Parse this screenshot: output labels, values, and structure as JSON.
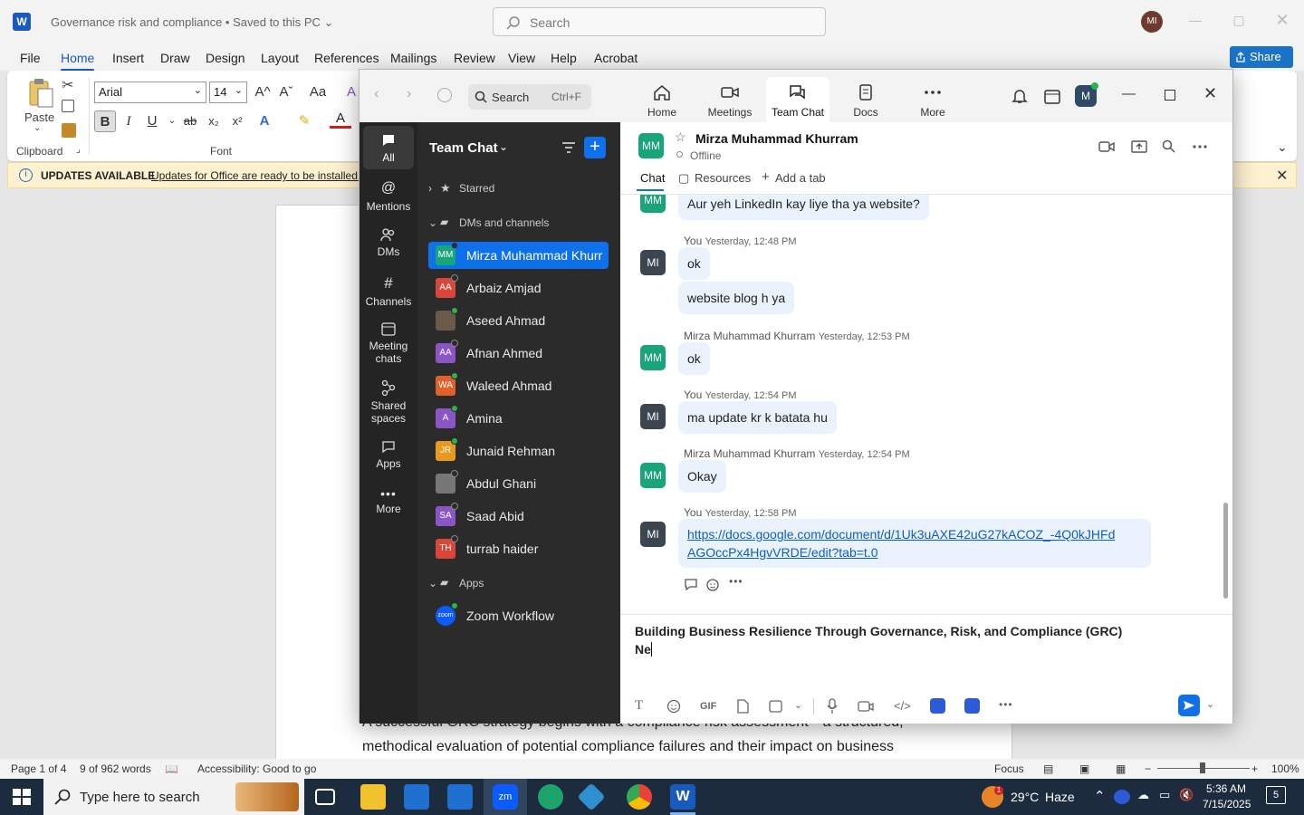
{
  "word": {
    "app_letter": "W",
    "doc_title": "Governance risk and compliance • Saved to this PC ⌄",
    "search_placeholder": "Search",
    "avatar": "MI",
    "share_label": "Share",
    "menu": [
      "File",
      "Home",
      "Insert",
      "Draw",
      "Design",
      "Layout",
      "References",
      "Mailings",
      "Review",
      "View",
      "Help",
      "Acrobat"
    ],
    "ribbon": {
      "paste_label": "Paste",
      "clipboard_label": "Clipboard",
      "font_label": "Font",
      "font_name": "Arial",
      "font_size": "14",
      "grow": "A^",
      "shrink": "Aˇ",
      "case": "Aa",
      "bold": "B",
      "italic": "I",
      "underline": "U",
      "strike": "ab",
      "sub": "x₂",
      "sup": "x²"
    },
    "update_bar": {
      "title": "UPDATES AVAILABLE",
      "message": "Updates for Office are ready to be installed..."
    },
    "doc_lines": [
      "A successful GRC strategy begins with a compliance risk assessment—a structured,",
      "methodical evaluation of potential compliance failures and their impact on business"
    ],
    "status": {
      "page": "Page 1 of 4",
      "words": "9 of 962 words",
      "accessibility": "Accessibility: Good to go",
      "focus": "Focus",
      "zoom": "100%"
    }
  },
  "taskbar": {
    "search_placeholder": "Type here to search",
    "weather_temp": "29°C",
    "weather_desc": "Haze",
    "time": "5:36 AM",
    "date": "7/15/2025",
    "notif_count": "5",
    "weather_badge": "1"
  },
  "zoom": {
    "search_placeholder": "Search",
    "search_shortcut": "Ctrl+F",
    "tabs": [
      {
        "label": "Home",
        "icon": "home-icon"
      },
      {
        "label": "Meetings",
        "icon": "video-icon"
      },
      {
        "label": "Team Chat",
        "icon": "chat-icon"
      },
      {
        "label": "Docs",
        "icon": "docs-icon"
      },
      {
        "label": "More",
        "icon": "more-icon"
      }
    ],
    "profile_initials": "M",
    "nav": [
      {
        "label": "All"
      },
      {
        "label": "Mentions"
      },
      {
        "label": "DMs"
      },
      {
        "label": "Channels"
      },
      {
        "label": "Meeting chats"
      },
      {
        "label": "Shared spaces"
      },
      {
        "label": "Apps"
      },
      {
        "label": "More"
      }
    ],
    "list": {
      "title": "Team Chat",
      "starred": "Starred",
      "dms_section": "DMs and channels",
      "apps_section": "Apps",
      "contacts": [
        {
          "initials": "MM",
          "name": "Mirza Muhammad Khurram",
          "color": "#19a57a"
        },
        {
          "initials": "AA",
          "name": "Arbaiz Amjad",
          "color": "#d9473a"
        },
        {
          "initials": "",
          "name": "Aseed Ahmad",
          "color": "#6b5a4a"
        },
        {
          "initials": "AA",
          "name": "Afnan Ahmed",
          "color": "#8b55c5"
        },
        {
          "initials": "WA",
          "name": "Waleed Ahmad",
          "color": "#e0622a"
        },
        {
          "initials": "A",
          "name": "Amina",
          "color": "#8b55c5"
        },
        {
          "initials": "JR",
          "name": "Junaid Rehman",
          "color": "#e89a1f"
        },
        {
          "initials": "",
          "name": "Abdul Ghani",
          "color": "#777777"
        },
        {
          "initials": "SA",
          "name": "Saad Abid",
          "color": "#8b55c5"
        },
        {
          "initials": "TH",
          "name": "turrab haider",
          "color": "#d9473a"
        }
      ],
      "app": {
        "name": "Zoom Workflow",
        "icon_text": "zoom"
      }
    },
    "chat": {
      "header_initials": "MM",
      "contact_name": "Mirza Muhammad Khurram",
      "status": "Offline",
      "tabs": {
        "chat": "Chat",
        "resources": "Resources",
        "add": "Add a tab"
      },
      "messages": [
        {
          "sender": "MM",
          "meta": "",
          "time": "",
          "text": "Aur yeh LinkedIn kay liye tha ya website?"
        },
        {
          "sender": "MI",
          "meta": "You",
          "time": "Yesterday, 12:48 PM",
          "text": "ok"
        },
        {
          "sender": "MI",
          "meta": "",
          "time": "",
          "text": "website blog h ya"
        },
        {
          "sender": "MM",
          "meta": "Mirza Muhammad Khurram",
          "time": "Yesterday, 12:53 PM",
          "text": "ok"
        },
        {
          "sender": "MI",
          "meta": "You",
          "time": "Yesterday, 12:54 PM",
          "text": "ma update kr k batata hu"
        },
        {
          "sender": "MM",
          "meta": "Mirza Muhammad Khurram",
          "time": "Yesterday, 12:54 PM",
          "text": "Okay"
        },
        {
          "sender": "MI",
          "meta": "You",
          "time": "Yesterday, 12:58 PM",
          "text": "https://docs.google.com/document/d/1Uk3uAXE42uG27kACOZ_-4Q0kJHFd",
          "text2": "AGOccPx4HgvVRDE/edit?tab=t.0"
        }
      ],
      "compose_line1": "Building Business Resilience Through Governance, Risk, and Compliance (GRC)",
      "compose_line2": "Ne",
      "toolbar_gif": "GIF"
    }
  }
}
